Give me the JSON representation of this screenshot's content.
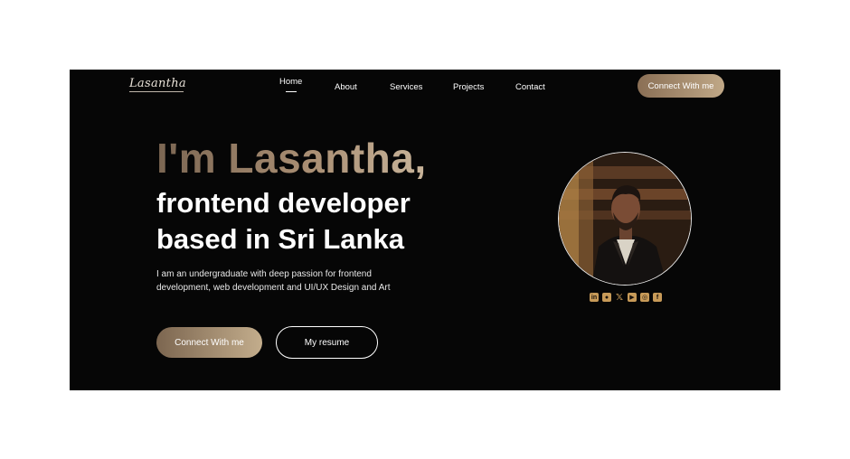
{
  "brand": {
    "logo_text": "Lasantha"
  },
  "nav": {
    "items": [
      {
        "label": "Home",
        "active": true
      },
      {
        "label": "About"
      },
      {
        "label": "Services"
      },
      {
        "label": "Projects"
      },
      {
        "label": "Contact"
      }
    ],
    "cta_label": "Connect With me"
  },
  "hero": {
    "headline_greeting": "I'm Lasantha,",
    "headline_line2": "frontend developer",
    "headline_line3": "based in Sri Lanka",
    "description_line1": "I am an undergraduate with deep passion for frontend",
    "description_line2": "development, web development and UI/UX Design and Art",
    "primary_button": "Connect With me",
    "secondary_button": "My resume"
  },
  "social": {
    "icons": [
      "linkedin-icon",
      "github-icon",
      "x-icon",
      "youtube-icon",
      "instagram-icon",
      "facebook-icon"
    ]
  },
  "colors": {
    "background": "#060606",
    "accent_gold_dark": "#7b6652",
    "accent_gold_light": "#c8b49a",
    "social_icon": "#c79a58",
    "text": "#ffffff"
  }
}
